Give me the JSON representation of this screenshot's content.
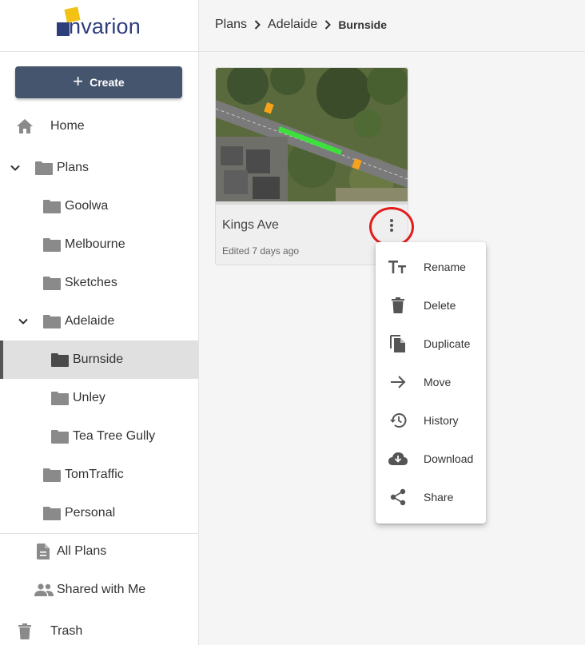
{
  "brand": {
    "name": "nvarion",
    "colors": {
      "navy": "#2e3e7a",
      "gold": "#f2c315"
    }
  },
  "sidebar": {
    "create_label": "Create",
    "items": [
      {
        "label": "Home",
        "icon": "home-icon"
      },
      {
        "label": "Plans",
        "icon": "folder-icon",
        "expanded": true
      },
      {
        "label": "Goolwa",
        "icon": "folder-icon"
      },
      {
        "label": "Melbourne",
        "icon": "folder-icon"
      },
      {
        "label": "Sketches",
        "icon": "folder-icon"
      },
      {
        "label": "Adelaide",
        "icon": "folder-icon",
        "expanded": true
      },
      {
        "label": "Burnside",
        "icon": "folder-icon",
        "selected": true
      },
      {
        "label": "Unley",
        "icon": "folder-icon"
      },
      {
        "label": "Tea Tree Gully",
        "icon": "folder-icon"
      },
      {
        "label": "TomTraffic",
        "icon": "folder-icon"
      },
      {
        "label": "Personal",
        "icon": "folder-icon"
      },
      {
        "label": "All Plans",
        "icon": "document-icon"
      },
      {
        "label": "Shared with Me",
        "icon": "people-icon"
      },
      {
        "label": "Trash",
        "icon": "trash-icon"
      }
    ]
  },
  "breadcrumb": [
    "Plans",
    "Adelaide",
    "Burnside"
  ],
  "plan_card": {
    "title": "Kings Ave",
    "edited": "Edited 7 days ago"
  },
  "context_menu": {
    "items": [
      {
        "label": "Rename",
        "icon": "text-format-icon"
      },
      {
        "label": "Delete",
        "icon": "trash-icon"
      },
      {
        "label": "Duplicate",
        "icon": "duplicate-icon"
      },
      {
        "label": "Move",
        "icon": "arrow-right-icon"
      },
      {
        "label": "History",
        "icon": "history-icon"
      },
      {
        "label": "Download",
        "icon": "cloud-download-icon"
      },
      {
        "label": "Share",
        "icon": "share-icon"
      }
    ]
  }
}
